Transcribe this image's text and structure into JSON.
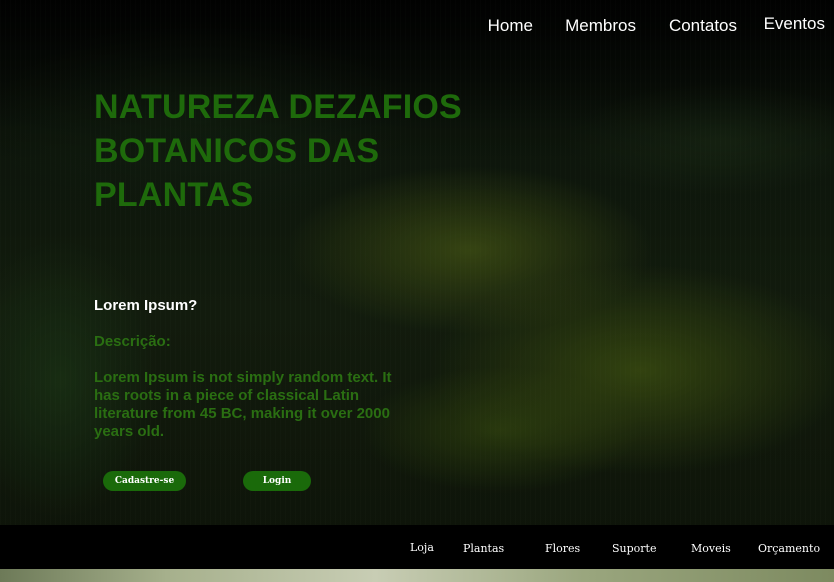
{
  "nav": {
    "items": [
      "Home",
      "Membros",
      "Contatos",
      "Eventos"
    ]
  },
  "hero": {
    "title": "NATUREZA DEZAFIOS BOTANICOS DAS PLANTAS",
    "question": "Lorem Ipsum?",
    "description_label": "Descrição:",
    "description_text": "Lorem Ipsum is not simply random text. It has roots in a piece of classical Latin literature from 45 BC, making it over 2000 years old.",
    "signup_label": "Cadastre-se",
    "login_label": "Login"
  },
  "footer": {
    "items": [
      "Loja",
      "Plantas",
      "Flores",
      "Suporte",
      "Moveis",
      "Orçamento"
    ]
  },
  "colors": {
    "accent_green": "#1e6a0b",
    "button_green": "#1a6a0a",
    "footer_bg": "#000000"
  }
}
